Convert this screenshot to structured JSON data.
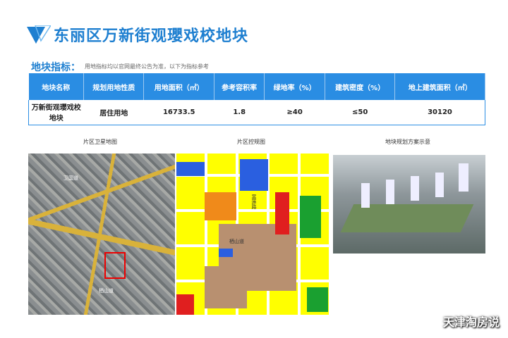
{
  "header": {
    "title": "东丽区万新街观瓔戏校地块"
  },
  "section": {
    "label": "地块指标：",
    "note": "用地指标均以官网最终公告为准，以下为指标参考"
  },
  "table": {
    "columns": [
      "地块名称",
      "规划用地性质",
      "用地面积（㎡）",
      "参考容积率",
      "绿地率（%）",
      "建筑密度（%）",
      "地上建筑面积（㎡）"
    ],
    "rows": [
      [
        "万新街观瓔戏校地块",
        "居住用地",
        "16733.5",
        "1.8",
        "≥40",
        "≤50",
        "30120"
      ]
    ]
  },
  "captions": {
    "satellite": "片区卫星地图",
    "control": "片区控规图",
    "render": "地块规划方案示意"
  },
  "map_labels": {
    "road1": "卫国道",
    "road2": "栖山道",
    "road3": "富莲路"
  },
  "watermark": "天津淘房说",
  "colors": {
    "accent": "#1e7fd0",
    "table_header": "#2a8de3"
  }
}
